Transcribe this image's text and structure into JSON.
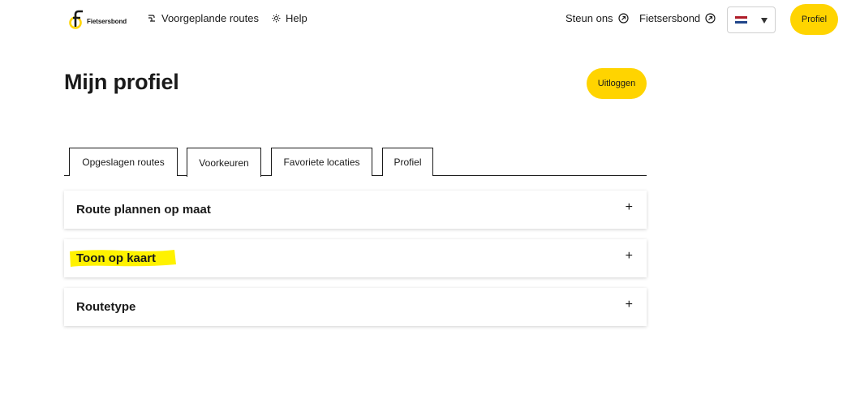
{
  "header": {
    "logo_text": "Fietsersbond",
    "nav_routes": "Voorgeplande routes",
    "nav_help": "Help",
    "nav_steun": "Steun ons",
    "nav_fietsersbond": "Fietsersbond",
    "language": {
      "selected": "Nederlands",
      "flag_colors": [
        "#ae1c28",
        "#ffffff",
        "#21468b"
      ]
    },
    "profile_button": "Profiel"
  },
  "main": {
    "title": "Mijn profiel",
    "logout_button": "Uitloggen",
    "tabs": [
      {
        "label": "Opgeslagen routes",
        "active": false
      },
      {
        "label": "Voorkeuren",
        "active": true
      },
      {
        "label": "Favoriete locaties",
        "active": false
      },
      {
        "label": "Profiel",
        "active": false
      }
    ],
    "sections": [
      {
        "title": "Route plannen op maat",
        "toggle": "+"
      },
      {
        "title": "Toon op kaart",
        "toggle": "+",
        "highlighted": true
      },
      {
        "title": "Routetype",
        "toggle": "+"
      }
    ]
  },
  "colors": {
    "accent": "#ffd400",
    "text": "#1a1a1a",
    "highlight": "#fff200"
  },
  "icons": {
    "routes": "route-icon",
    "help": "sun-help-icon",
    "external": "external-link-icon",
    "caret": "chevron-down-icon"
  }
}
